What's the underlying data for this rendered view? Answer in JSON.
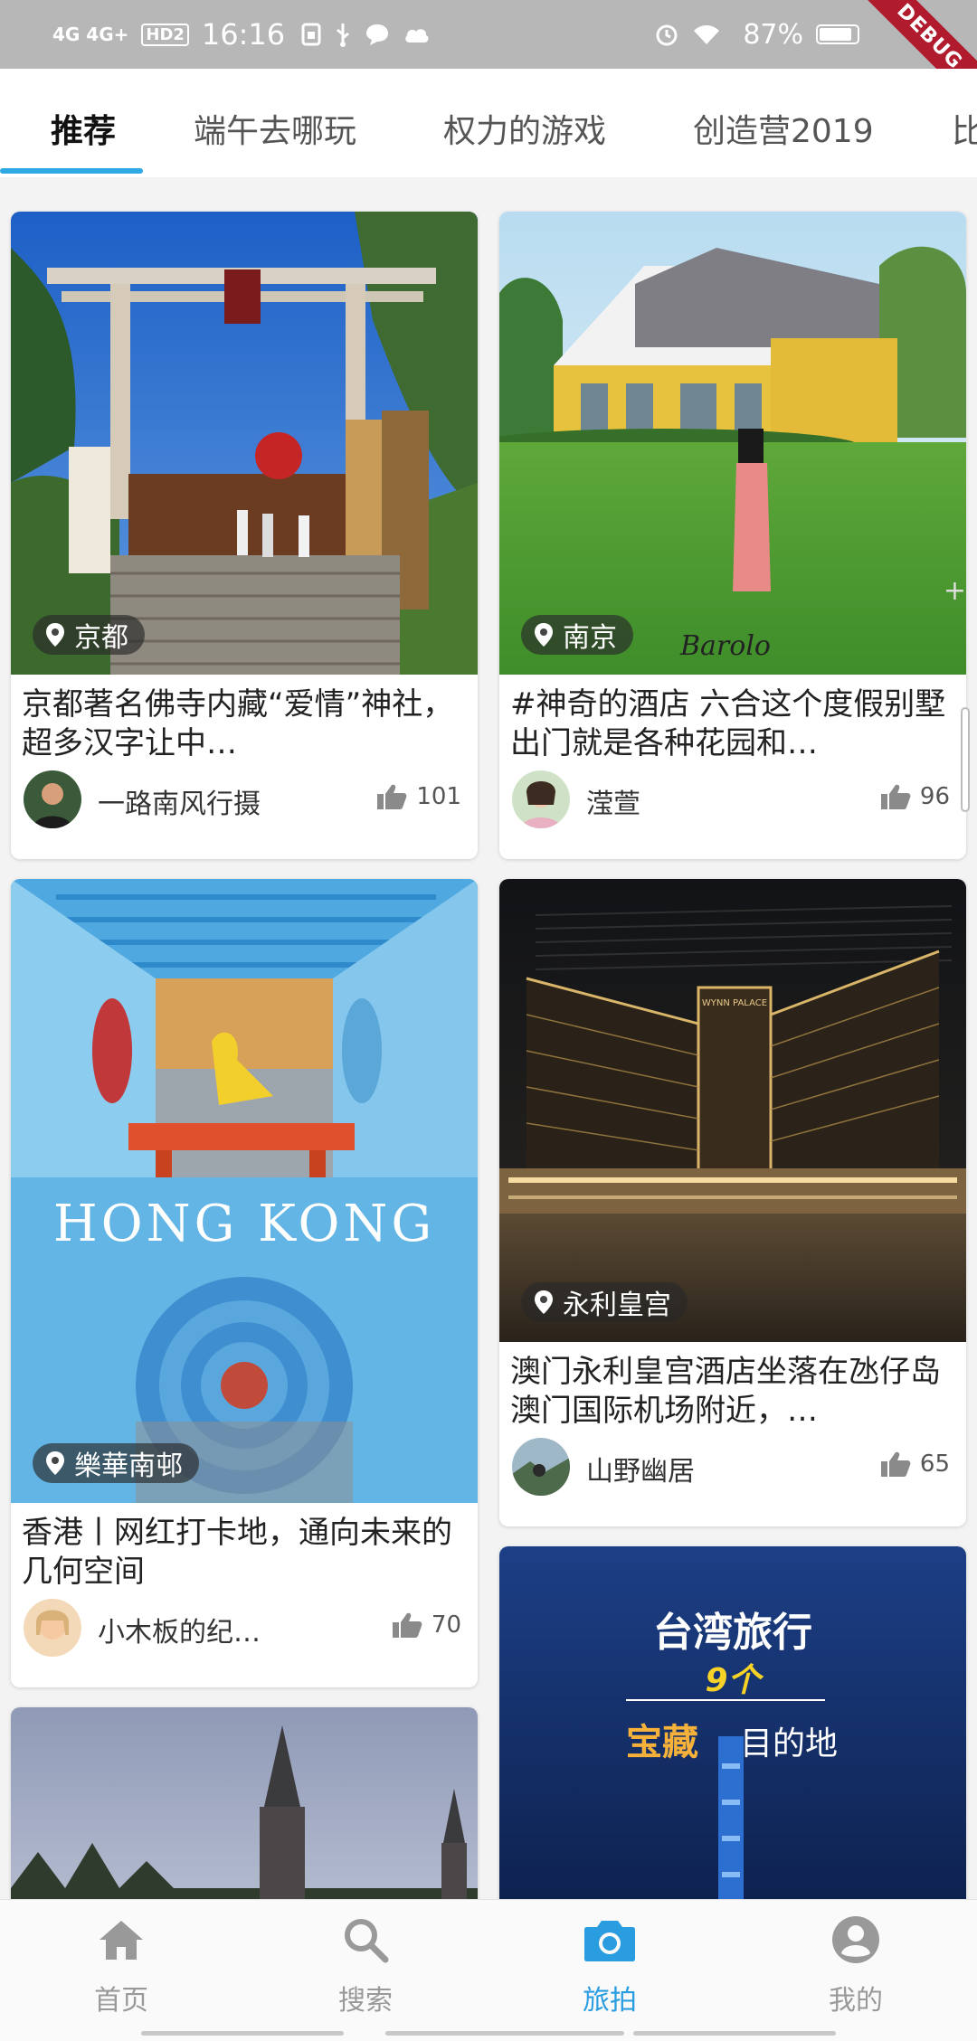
{
  "status_bar": {
    "network": "4G 4G+",
    "hd": "HD2",
    "time": "16:16",
    "battery": "87%",
    "battery_level": 0.87,
    "debug": "DEBUG"
  },
  "tabs": [
    {
      "label": "推荐",
      "active": true
    },
    {
      "label": "端午去哪玩",
      "active": false
    },
    {
      "label": "权力的游戏",
      "active": false
    },
    {
      "label": "创造营2019",
      "active": false
    },
    {
      "label": "比",
      "active": false
    }
  ],
  "cards": [
    {
      "location": "京都",
      "title": "京都著名佛寺内藏“爱情”神社，超多汉字让中…",
      "author": "一路南风行摄",
      "likes": "101"
    },
    {
      "location": "南京",
      "title": "#神奇的酒店 六合这个度假别墅 出门就是各种花园和…",
      "author": "滢萱",
      "likes": "96"
    },
    {
      "location": "樂華南邨",
      "title": "香港丨网红打卡地，通向未来的几何空间",
      "author": "小木板的纪…",
      "likes": "70",
      "image_text": "HONG KONG"
    },
    {
      "location": "永利皇宫",
      "title": "澳门永利皇宫酒店坐落在氹仔岛澳门国际机场附近，…",
      "author": "山野幽居",
      "likes": "65",
      "image_text": "WYNN PALACE"
    },
    {
      "location": "",
      "title": "",
      "author": "",
      "likes": ""
    },
    {
      "location": "",
      "title": "",
      "author": "",
      "likes": "",
      "image_text_1": "台湾旅行",
      "image_text_2": "9个",
      "image_text_3": "宝藏",
      "image_text_4": "目的地"
    }
  ],
  "bottom_nav": [
    {
      "label": "首页",
      "icon": "home-icon",
      "active": false
    },
    {
      "label": "搜索",
      "icon": "search-icon",
      "active": false
    },
    {
      "label": "旅拍",
      "icon": "camera-icon",
      "active": true
    },
    {
      "label": "我的",
      "icon": "profile-icon",
      "active": false
    }
  ],
  "colors": {
    "accent": "#2fa8e4",
    "active_nav": "#2a9de0",
    "debug_ribbon": "#b01b2e"
  }
}
